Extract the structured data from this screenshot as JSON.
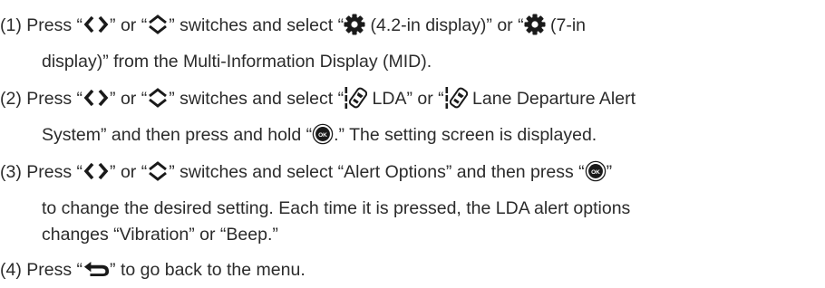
{
  "steps": [
    {
      "num": "(1)",
      "lines": [
        {
          "a": "Press “",
          "b": "” or “",
          "c": "” switches and select “",
          "d": " (4.2-in display)” or “",
          "e": " (7-in"
        },
        {
          "text": "display)” from the Multi-Information Display (MID)."
        }
      ]
    },
    {
      "num": "(2)",
      "lines": [
        {
          "a": "Press “",
          "b": "” or “",
          "c": "” switches and select “",
          "d": " LDA” or “",
          "e": " Lane Departure Alert"
        },
        {
          "a": "System” and then press and hold “",
          "b": ".” The setting screen is displayed."
        }
      ]
    },
    {
      "num": "(3)",
      "lines": [
        {
          "a": "Press “",
          "b": "” or “",
          "c": "” switches and select “Alert Options” and then press “",
          "d": "”"
        },
        {
          "text": "to change the desired setting. Each time it is pressed, the LDA alert options"
        },
        {
          "text": "changes “Vibration” or “Beep.”"
        }
      ]
    },
    {
      "num": "(4)",
      "lines": [
        {
          "a": "Press “",
          "b": "” to go back to the menu."
        }
      ]
    }
  ],
  "icons": {
    "left_right": "left-right-arrows-icon",
    "up_down": "up-down-arrows-icon",
    "settings": "gear-icon",
    "lda": "lane-departure-icon",
    "ok": "ok-button-icon",
    "back": "back-arrow-icon"
  },
  "ok_label": "OK",
  "colors": {
    "text": "#2b2b2b",
    "icon": "#1a1a1a"
  }
}
